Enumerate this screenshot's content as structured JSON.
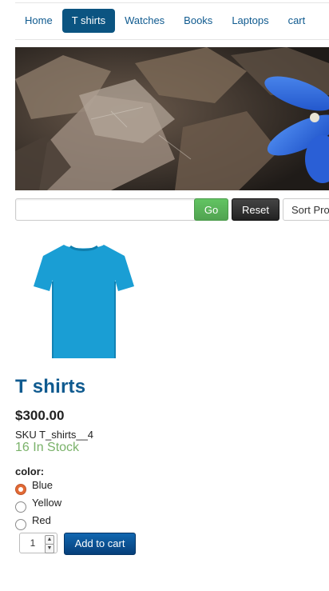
{
  "nav": {
    "items": [
      {
        "label": "Home",
        "active": false
      },
      {
        "label": "T shirts",
        "active": true
      },
      {
        "label": "Watches",
        "active": false
      },
      {
        "label": "Books",
        "active": false
      },
      {
        "label": "Laptops",
        "active": false
      },
      {
        "label": "cart",
        "active": false
      }
    ]
  },
  "search": {
    "value": "",
    "go_label": "Go",
    "reset_label": "Reset",
    "sort_label": "Sort Products"
  },
  "product": {
    "title": "T shirts",
    "price": "$300.00",
    "sku": "SKU T_shirts__4",
    "stock": "16 In Stock",
    "image_icon": "t-shirt-icon",
    "shirt_color": "#1a9ed4",
    "color_option_label": "color:",
    "color_options": [
      {
        "label": "Blue",
        "selected": true
      },
      {
        "label": "Yellow",
        "selected": false
      },
      {
        "label": "Red",
        "selected": false
      }
    ],
    "quantity": "1",
    "add_to_cart_label": "Add to cart"
  },
  "colors": {
    "link": "#0f5a8f",
    "nav_active_bg": "#0b5481",
    "stock_green": "#7ab26a",
    "go_green": "#5bb75b",
    "reset_dark": "#333333",
    "cart_button": "#0b4f8f",
    "radio_selected": "#e26a35"
  }
}
